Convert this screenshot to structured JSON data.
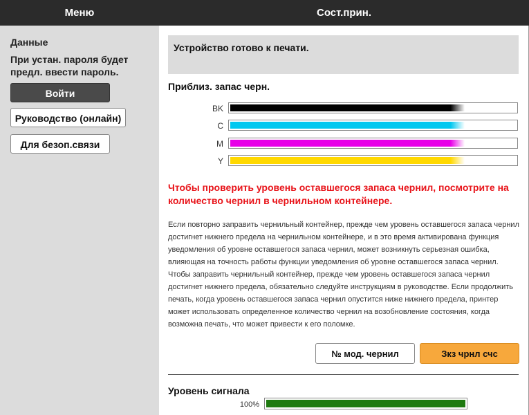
{
  "header": {
    "menu_label": "Меню",
    "title": "Сост.прин."
  },
  "sidebar": {
    "title": "Данные",
    "description": "При устан. пароля будет предл. ввести пароль.",
    "buttons": {
      "login": "Войти",
      "guide": "Руководство (онлайн)",
      "secure": "Для безоп.связи"
    }
  },
  "main": {
    "status": "Устройство готово к печати.",
    "ink_title": "Приблиз. запас черн.",
    "inks": [
      {
        "label": "BK",
        "color": "#000000",
        "level": 0.82
      },
      {
        "label": "C",
        "color": "#00c8f0",
        "level": 0.82
      },
      {
        "label": "M",
        "color": "#e800e8",
        "level": 0.82
      },
      {
        "label": "Y",
        "color": "#ffd800",
        "level": 0.82
      }
    ],
    "warning": "Чтобы проверить уровень оставшегося запаса чернил, посмотрите на количество чернил в чернильном контейнере.",
    "paragraph": "Если повторно заправить чернильный контейнер, прежде чем уровень оставшегося запаса чернил достигнет нижнего предела на чернильном контейнере, и в это время активирована функция уведомления об уровне оставшегося запаса чернил, может возникнуть серьезная ошибка, влияющая на точность работы функции уведомления об уровне оставшегося запаса чернил. Чтобы заправить чернильный контейнер, прежде чем уровень оставшегося запаса чернил достигнет нижнего предела, обязательно следуйте инструкциям в руководстве. Если продолжить печать, когда уровень оставшегося запаса чернил опустится ниже нижнего предела, принтер может использовать определенное количество чернил на возобновление состояния, когда возможна печать, что может привести к его поломке.",
    "buttons": {
      "model": "№ мод. чернил",
      "order": "Зкз чрнл счс"
    },
    "signal": {
      "title": "Уровень сигнала",
      "percent_label": "100%",
      "level": 1.0,
      "color": "#1e7a10"
    }
  }
}
